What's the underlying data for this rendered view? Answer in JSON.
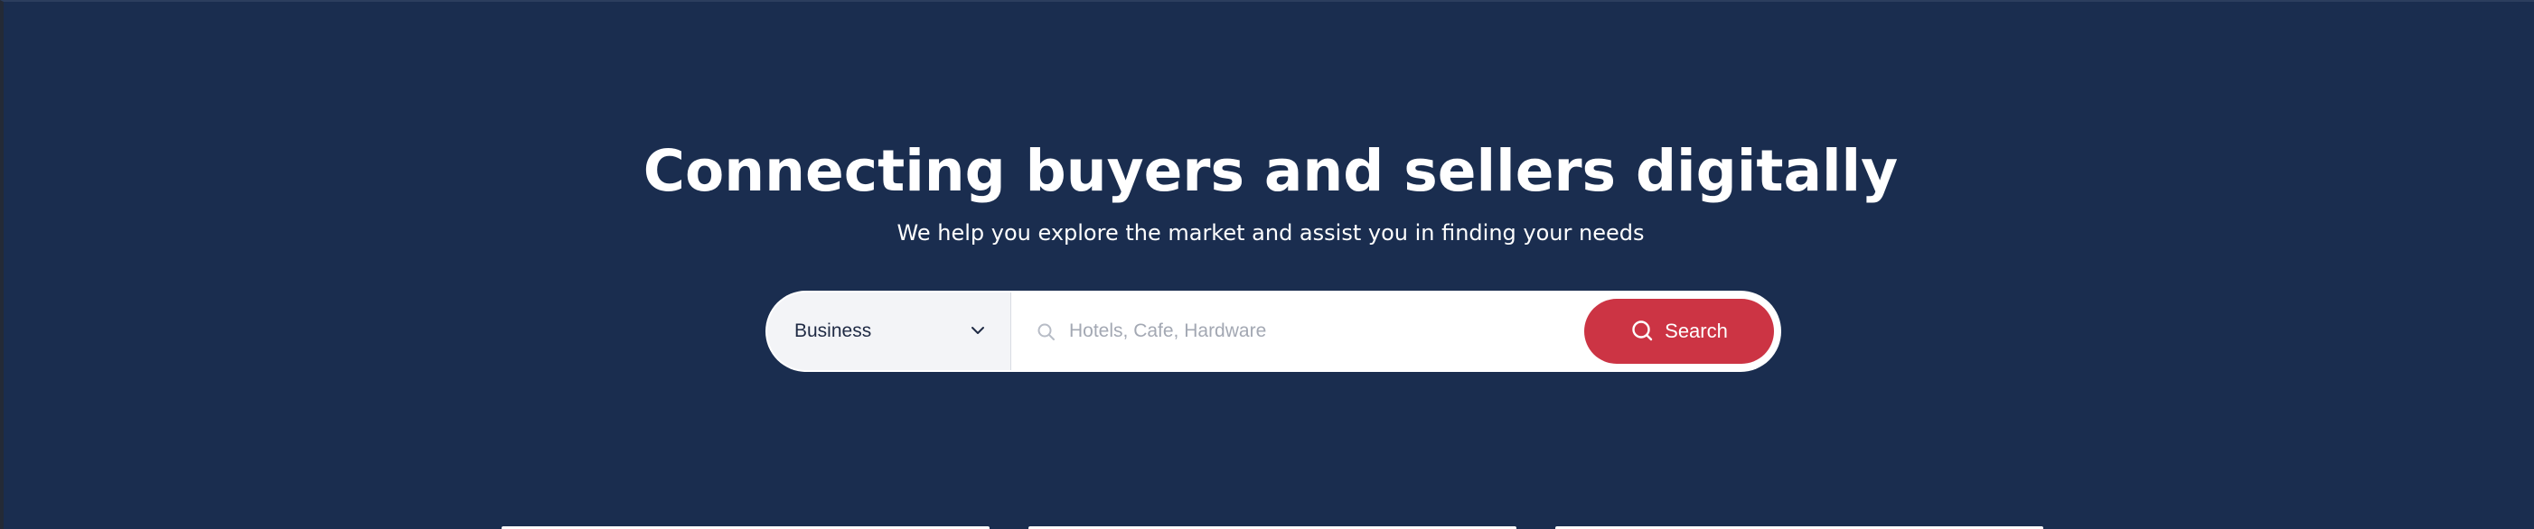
{
  "hero": {
    "title": "Connecting buyers and sellers digitally",
    "subtitle": "We help you explore the market and assist you in finding your needs"
  },
  "search": {
    "category_selected": "Business",
    "category_icon": "chevron-down-icon",
    "query_placeholder": "Hotels, Cafe, Hardware",
    "query_value": "",
    "query_icon": "search-icon",
    "button_label": "Search",
    "button_icon": "search-icon"
  },
  "colors": {
    "background": "#1a2d4f",
    "accent": "#cc3444",
    "text_light": "#ffffff",
    "select_background": "#f3f4f7",
    "placeholder": "#a3a8b3"
  }
}
